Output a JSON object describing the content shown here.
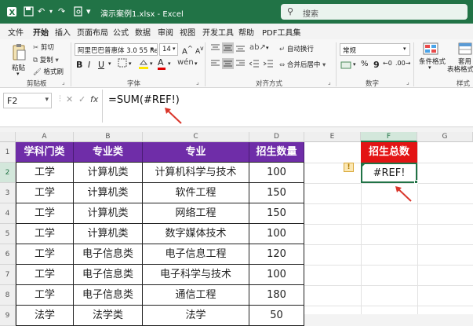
{
  "titlebar": {
    "title": "演示案例1.xlsx  -  Excel",
    "search_placeholder": "搜索"
  },
  "tabs": [
    "文件",
    "开始",
    "插入",
    "页面布局",
    "公式",
    "数据",
    "审阅",
    "视图",
    "开发工具",
    "帮助",
    "PDF工具集"
  ],
  "active_tab": "开始",
  "ribbon": {
    "clipboard": {
      "paste": "粘贴",
      "cut": "剪切",
      "copy": "复制",
      "format_painter": "格式刷",
      "group": "剪贴板"
    },
    "font": {
      "family": "阿里巴巴普惠体 3.0 55 Regu",
      "size": "14",
      "group": "字体"
    },
    "alignment": {
      "wrap": "自动换行",
      "merge": "合并后居中",
      "group": "对齐方式"
    },
    "number": {
      "format": "常规",
      "group": "数字"
    },
    "styles": {
      "conditional": "条件格式",
      "table": "套用\n表格格式",
      "group": "样式"
    }
  },
  "formula_bar": {
    "name_box": "F2",
    "fx": "fx",
    "formula": "=SUM(#REF!)"
  },
  "columns": [
    "A",
    "B",
    "C",
    "D",
    "E",
    "F",
    "G"
  ],
  "rows": [
    "1",
    "2",
    "3",
    "4",
    "5",
    "6",
    "7",
    "8",
    "9"
  ],
  "table": {
    "headers": [
      "学科门类",
      "专业类",
      "专业",
      "招生数量"
    ],
    "rows": [
      [
        "工学",
        "计算机类",
        "计算机科学与技术",
        "100"
      ],
      [
        "工学",
        "计算机类",
        "软件工程",
        "150"
      ],
      [
        "工学",
        "计算机类",
        "网络工程",
        "150"
      ],
      [
        "工学",
        "计算机类",
        "数字媒体技术",
        "100"
      ],
      [
        "工学",
        "电子信息类",
        "电子信息工程",
        "120"
      ],
      [
        "工学",
        "电子信息类",
        "电子科学与技术",
        "100"
      ],
      [
        "工学",
        "电子信息类",
        "通信工程",
        "180"
      ],
      [
        "法学",
        "法学类",
        "法学",
        "50"
      ]
    ]
  },
  "total": {
    "header": "招生总数",
    "value": "#REF!"
  },
  "colors": {
    "excel_green": "#217346",
    "header_purple": "#6f2da8",
    "total_red": "#e31414",
    "arrow": "#d9362b"
  }
}
